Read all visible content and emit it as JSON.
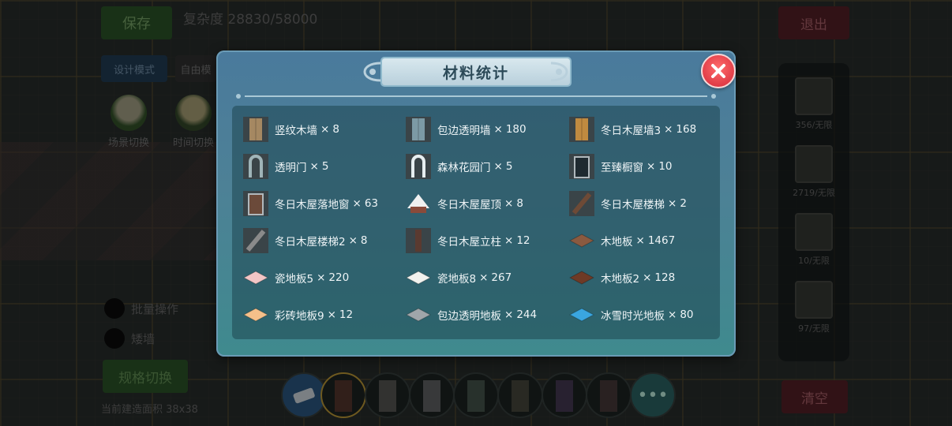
{
  "background": {
    "save_label": "保存",
    "complexity_label": "复杂度 28830/58000",
    "exit_label": "退出",
    "design_mode_label": "设计模式",
    "free_mode_label": "自由模",
    "scene_switch_label": "场景切换",
    "time_switch_label": "时间切换",
    "batch_label": "批量操作",
    "wall_label": "矮墙",
    "spec_switch_label": "规格切换",
    "area_label": "当前建造面积 38x38",
    "clear_label": "清空",
    "right_panel": [
      "356/无限",
      "2719/无限",
      "10/无限",
      "97/无限"
    ]
  },
  "modal": {
    "title": "材料统计",
    "close_icon": "close-x-icon",
    "items": [
      {
        "name": "竖纹木墙",
        "count": "8",
        "icon": "vertical-wood-wall-icon",
        "color": "#a58862"
      },
      {
        "name": "包边透明墙",
        "count": "180",
        "icon": "glass-wall-icon",
        "color": "#7c9aa5"
      },
      {
        "name": "冬日木屋墙3",
        "count": "168",
        "icon": "cabin-wall-icon",
        "color": "#c08a40"
      },
      {
        "name": "透明门",
        "count": "5",
        "icon": "glass-door-icon",
        "color": "#9fb4b8"
      },
      {
        "name": "森林花园门",
        "count": "5",
        "icon": "garden-door-icon",
        "color": "#e6eef0"
      },
      {
        "name": "至臻橱窗",
        "count": "10",
        "icon": "showcase-window-icon",
        "color": "#1f2a30"
      },
      {
        "name": "冬日木屋落地窗",
        "count": "63",
        "icon": "french-window-icon",
        "color": "#6b4a3a"
      },
      {
        "name": "冬日木屋屋顶",
        "count": "8",
        "icon": "roof-icon",
        "color": "#f0f0f0"
      },
      {
        "name": "冬日木屋楼梯",
        "count": "2",
        "icon": "stairs-icon",
        "color": "#6e4a36"
      },
      {
        "name": "冬日木屋楼梯2",
        "count": "8",
        "icon": "stairs2-icon",
        "color": "#8a8a8a"
      },
      {
        "name": "冬日木屋立柱",
        "count": "12",
        "icon": "pillar-icon",
        "color": "#5a3a30"
      },
      {
        "name": "木地板",
        "count": "1467",
        "icon": "wood-floor-icon",
        "color": "#8a5a40"
      },
      {
        "name": "瓷地板5",
        "count": "220",
        "icon": "tile-floor-icon",
        "color": "#f2c6c6"
      },
      {
        "name": "瓷地板8",
        "count": "267",
        "icon": "tile-floor-icon",
        "color": "#f2f2ee"
      },
      {
        "name": "木地板2",
        "count": "128",
        "icon": "wood-floor-icon",
        "color": "#6e3a26"
      },
      {
        "name": "彩砖地板9",
        "count": "12",
        "icon": "color-brick-floor-icon",
        "color": "#f5c08a"
      },
      {
        "name": "包边透明地板",
        "count": "244",
        "icon": "glass-floor-icon",
        "color": "#a0a6aa"
      },
      {
        "name": "冰雪时光地板",
        "count": "80",
        "icon": "ice-floor-icon",
        "color": "#3aa6e0"
      }
    ]
  }
}
